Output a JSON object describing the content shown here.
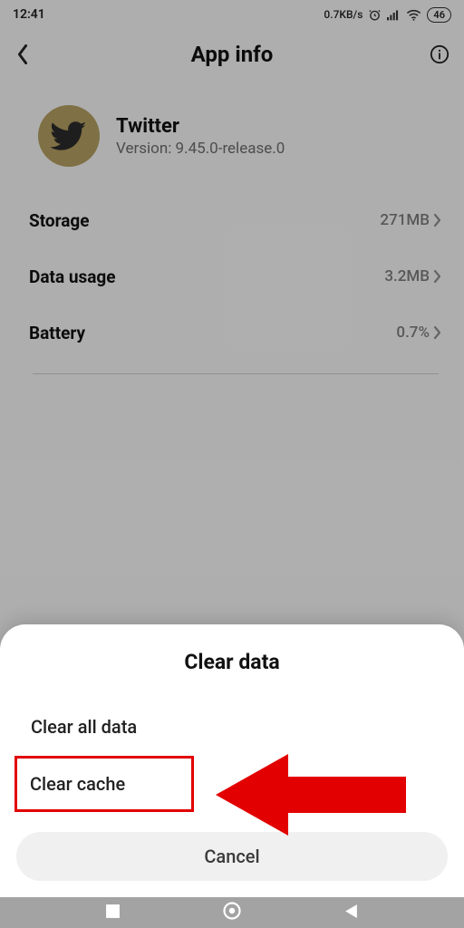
{
  "status": {
    "time": "12:41",
    "net_speed": "0.7KB/s",
    "battery": "46"
  },
  "header": {
    "title": "App info"
  },
  "app": {
    "name": "Twitter",
    "version": "Version: 9.45.0-release.0"
  },
  "rows": {
    "storage": {
      "label": "Storage",
      "value": "271MB"
    },
    "data": {
      "label": "Data usage",
      "value": "3.2MB"
    },
    "battery": {
      "label": "Battery",
      "value": "0.7%"
    }
  },
  "sheet": {
    "title": "Clear data",
    "option_all": "Clear all data",
    "option_cache": "Clear cache",
    "cancel": "Cancel"
  }
}
